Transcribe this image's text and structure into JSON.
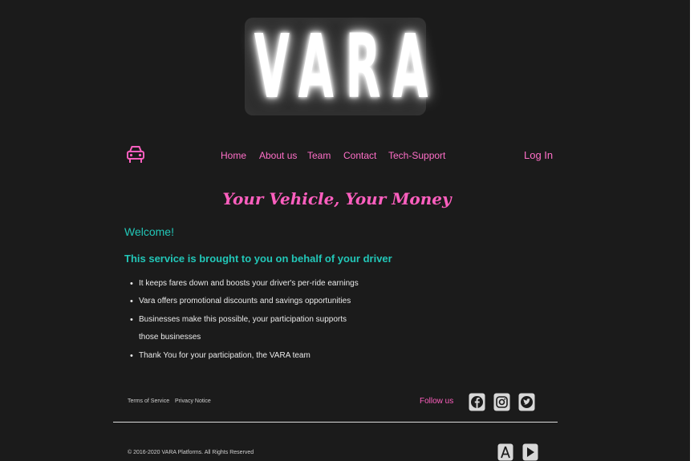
{
  "brand": {
    "logo_text": "VARA"
  },
  "nav": {
    "items": [
      {
        "label": "Home"
      },
      {
        "label": "About us"
      },
      {
        "label": "Team"
      },
      {
        "label": "Contact"
      },
      {
        "label": "Tech-Support"
      }
    ],
    "login_label": "Log In"
  },
  "hero": {
    "tagline": "Your Vehicle, Your Money"
  },
  "content": {
    "welcome": "Welcome!",
    "subheading": "This service is brought to you on behalf of your driver",
    "bullets": [
      "It keeps fares down and boosts your driver's per-ride earnings",
      "Vara offers promotional discounts and savings opportunities",
      "Businesses make this possible, your participation supports those businesses",
      "Thank You for your participation, the VARA team"
    ]
  },
  "footer": {
    "terms_label": "Terms of Service",
    "privacy_label": "Privacy Notice",
    "follow_label": "Follow us",
    "social_icons": [
      "facebook-icon",
      "instagram-icon",
      "twitter-icon"
    ],
    "store_icons": [
      "app-store-icon",
      "google-play-icon"
    ],
    "copyright": "© 2016-2020 VARA Platforms. All Rights Reserved"
  },
  "colors": {
    "background": "#1b1b1b",
    "accent_pink": "#ff6fc8",
    "accent_teal": "#22c7b8"
  }
}
